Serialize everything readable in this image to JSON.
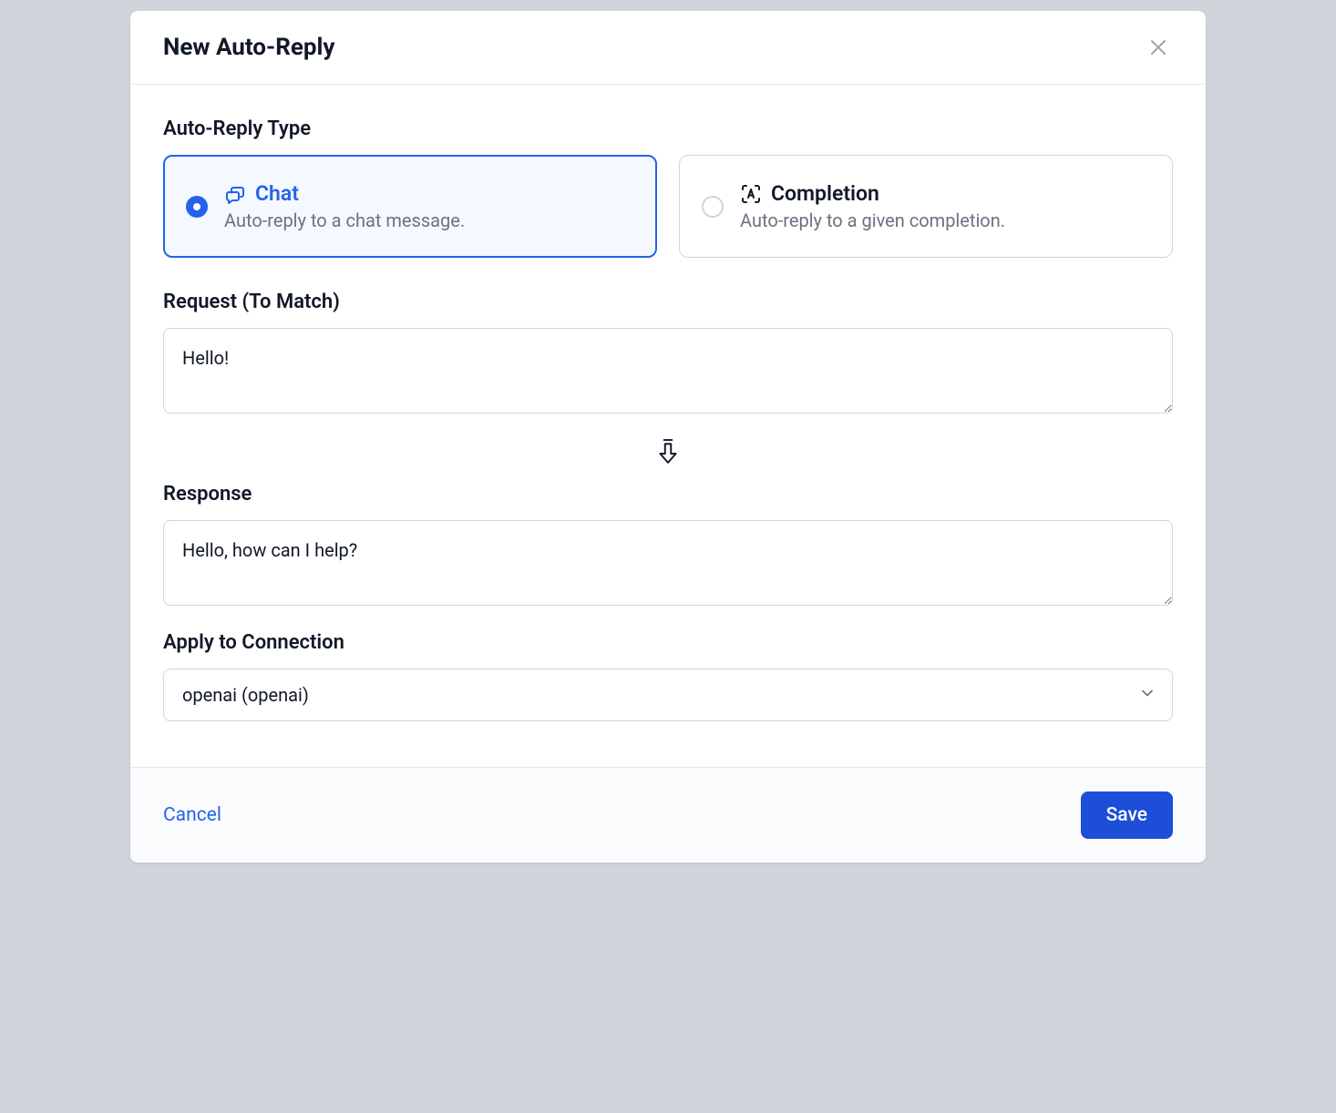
{
  "modal": {
    "title": "New Auto-Reply"
  },
  "type_section": {
    "label": "Auto-Reply Type",
    "chat": {
      "title": "Chat",
      "desc": "Auto-reply to a chat message."
    },
    "completion": {
      "title": "Completion",
      "desc": "Auto-reply to a given completion."
    }
  },
  "request": {
    "label": "Request (To Match)",
    "value": "Hello!"
  },
  "response": {
    "label": "Response",
    "value": "Hello, how can I help?"
  },
  "connection": {
    "label": "Apply to Connection",
    "value": "openai (openai)"
  },
  "footer": {
    "cancel": "Cancel",
    "save": "Save"
  }
}
